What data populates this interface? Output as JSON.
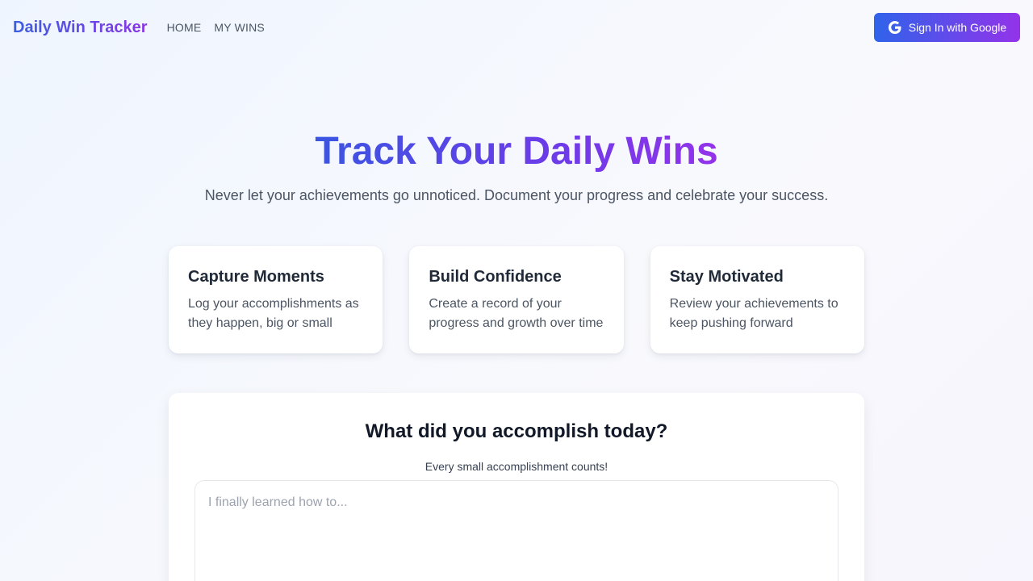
{
  "nav": {
    "brand": "Daily Win Tracker",
    "links": [
      "HOME",
      "MY WINS"
    ],
    "signin_label": "Sign In with Google",
    "signin_icon": "google-icon"
  },
  "hero": {
    "title": "Track Your Daily Wins",
    "subtitle": "Never let your achievements go unnoticed. Document your progress and celebrate your success."
  },
  "features": [
    {
      "title": "Capture Moments",
      "text": "Log your accomplishments as they happen, big or small"
    },
    {
      "title": "Build Confidence",
      "text": "Create a record of your progress and growth over time"
    },
    {
      "title": "Stay Motivated",
      "text": "Review your achievements to keep pushing forward"
    }
  ],
  "form": {
    "title": "What did you accomplish today?",
    "subtitle": "Every small accomplishment counts!",
    "input_value": "",
    "input_placeholder": "I finally learned how to..."
  },
  "colors": {
    "accent_start": "#2f63ea",
    "accent_end": "#9333ea",
    "text_muted": "#4b5563"
  }
}
